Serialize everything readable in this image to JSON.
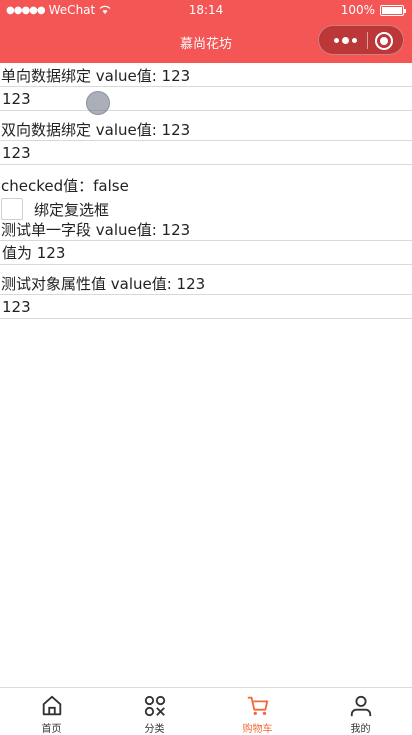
{
  "status_bar": {
    "carrier": "WeChat",
    "time": "18:14",
    "battery": "100%"
  },
  "nav": {
    "title": "慕尚花坊"
  },
  "form": {
    "one_way_label": "单向数据绑定 value值: 123",
    "one_way_value": "123",
    "two_way_label": "双向数据绑定 value值: 123",
    "two_way_value": "123",
    "checked_label": "checked值：false",
    "checkbox_label": "绑定复选框",
    "single_field_label": "测试单一字段 value值: 123",
    "single_field_value": "值为 123",
    "object_prop_label": "测试对象属性值 value值: 123",
    "object_prop_value": "123"
  },
  "tabbar": {
    "items": [
      {
        "label": "首页",
        "icon": "home-icon"
      },
      {
        "label": "分类",
        "icon": "category-icon"
      },
      {
        "label": "购物车",
        "icon": "cart-icon",
        "active": true
      },
      {
        "label": "我的",
        "icon": "user-icon"
      }
    ],
    "active_color": "#f26a3a"
  },
  "colors": {
    "brand": "#f45555"
  }
}
